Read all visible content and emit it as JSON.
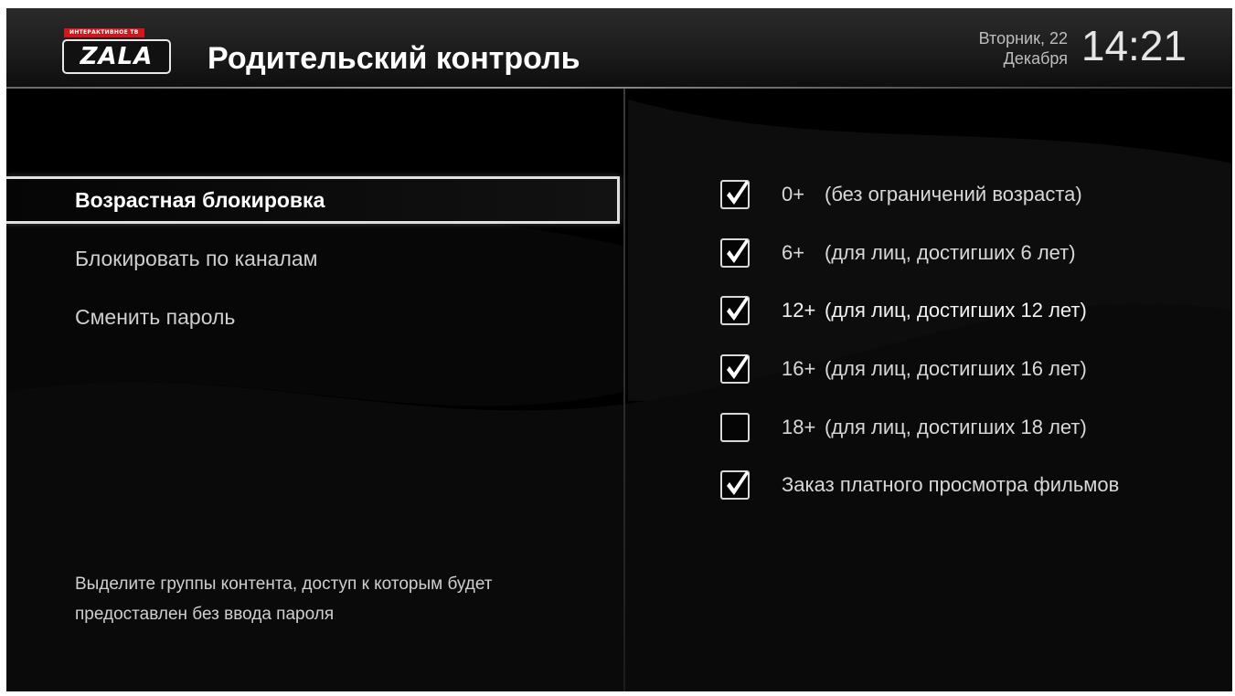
{
  "header": {
    "logo_tag": "ИНТЕРАКТИВНОЕ ТВ",
    "logo_text": "ZALA",
    "title": "Родительский контроль",
    "date_line1": "Вторник, 22",
    "date_line2": "Декабря",
    "time": "14:21"
  },
  "menu": {
    "items": [
      {
        "label": "Возрастная блокировка",
        "active": true
      },
      {
        "label": "Блокировать по каналам",
        "active": false
      },
      {
        "label": "Сменить пароль",
        "active": false
      }
    ],
    "hint": "Выделите группы контента, доступ к которым будет предоставлен без ввода пароля"
  },
  "options": [
    {
      "age": "0+",
      "desc": "(без ограничений возраста)",
      "checked": true
    },
    {
      "age": "6+",
      "desc": "(для лиц, достигших 6 лет)",
      "checked": true
    },
    {
      "age": "12+",
      "desc": "(для лиц, достигших 12 лет)",
      "checked": true
    },
    {
      "age": "16+",
      "desc": "(для лиц, достигших 16 лет)",
      "checked": true
    },
    {
      "age": "18+",
      "desc": "(для лиц, достигших 18 лет)",
      "checked": false
    },
    {
      "label": "Заказ платного просмотра фильмов",
      "checked": true
    }
  ],
  "colors": {
    "background": "#000000",
    "text": "#d8d8d8",
    "accent_red": "#d6141c",
    "focus_border": "#e0e0e0"
  }
}
